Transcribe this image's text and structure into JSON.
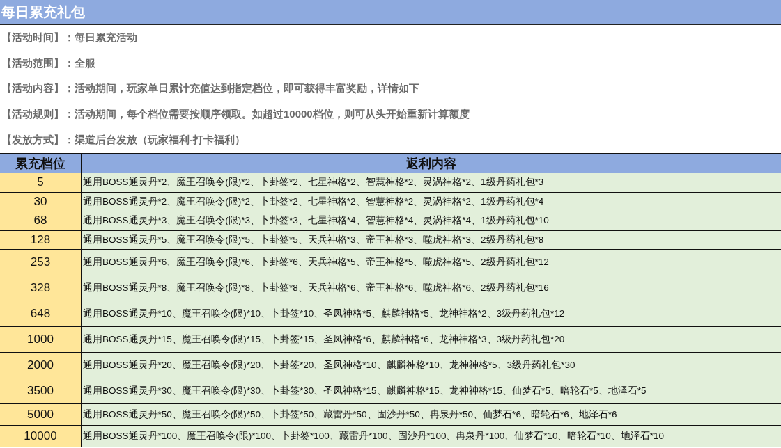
{
  "title": "每日累充礼包",
  "info": [
    {
      "label": "【活动时间】：",
      "value": "每日累充活动"
    },
    {
      "label": "【活动范围】：",
      "value": "全服"
    },
    {
      "label": "【活动内容】：",
      "value": "活动期间，玩家单日累计充值达到指定档位，即可获得丰富奖励，详情如下"
    },
    {
      "label": "【活动规则】：",
      "value": "活动期间，每个档位需要按顺序领取。如超过10000档位，则可从头开始重新计算额度"
    },
    {
      "label": "【发放方式】：",
      "value": "渠道后台发放（玩家福利-打卡福利）"
    }
  ],
  "table": {
    "columns": [
      "累充档位",
      "返利内容"
    ],
    "rows": [
      {
        "tier": "5",
        "rewards": "通用BOSS通灵丹*2、魔王召唤令(限)*2、卜卦签*2、七星神格*2、智慧神格*2、灵涡神格*2、1级丹药礼包*3"
      },
      {
        "tier": "30",
        "rewards": "通用BOSS通灵丹*2、魔王召唤令(限)*2、卜卦签*2、七星神格*2、智慧神格*2、灵涡神格*2、1级丹药礼包*4"
      },
      {
        "tier": "68",
        "rewards": "通用BOSS通灵丹*3、魔王召唤令(限)*3、卜卦签*3、七星神格*4、智慧神格*4、灵涡神格*4、1级丹药礼包*10"
      },
      {
        "tier": "128",
        "rewards": "通用BOSS通灵丹*5、魔王召唤令(限)*5、卜卦签*5、天兵神格*3、帝王神格*3、噬虎神格*3、2级丹药礼包*8"
      },
      {
        "tier": "253",
        "rewards": "通用BOSS通灵丹*6、魔王召唤令(限)*6、卜卦签*6、天兵神格*5、帝王神格*5、噬虎神格*5、2级丹药礼包*12"
      },
      {
        "tier": "328",
        "rewards": "通用BOSS通灵丹*8、魔王召唤令(限)*8、卜卦签*8、天兵神格*6、帝王神格*6、噬虎神格*6、2级丹药礼包*16"
      },
      {
        "tier": "648",
        "rewards": "通用BOSS通灵丹*10、魔王召唤令(限)*10、卜卦签*10、圣凤神格*5、麒麟神格*5、龙神神格*2、3级丹药礼包*12"
      },
      {
        "tier": "1000",
        "rewards": "通用BOSS通灵丹*15、魔王召唤令(限)*15、卜卦签*15、圣凤神格*6、麒麟神格*6、龙神神格*3、3级丹药礼包*20"
      },
      {
        "tier": "2000",
        "rewards": "通用BOSS通灵丹*20、魔王召唤令(限)*20、卜卦签*20、圣凤神格*10、麒麟神格*10、龙神神格*5、3级丹药礼包*30"
      },
      {
        "tier": "3500",
        "rewards": "通用BOSS通灵丹*30、魔王召唤令(限)*30、卜卦签*30、圣凤神格*15、麒麟神格*15、龙神神格*15、仙梦石*5、暗轮石*5、地泽石*5"
      },
      {
        "tier": "5000",
        "rewards": "通用BOSS通灵丹*50、魔王召唤令(限)*50、卜卦签*50、藏雷丹*50、固沙丹*50、冉泉丹*50、仙梦石*6、暗轮石*6、地泽石*6"
      },
      {
        "tier": "10000",
        "rewards": "通用BOSS通灵丹*100、魔王召唤令(限)*100、卜卦签*100、藏雷丹*100、固沙丹*100、冉泉丹*100、仙梦石*10、暗轮石*10、地泽石*10"
      }
    ]
  }
}
